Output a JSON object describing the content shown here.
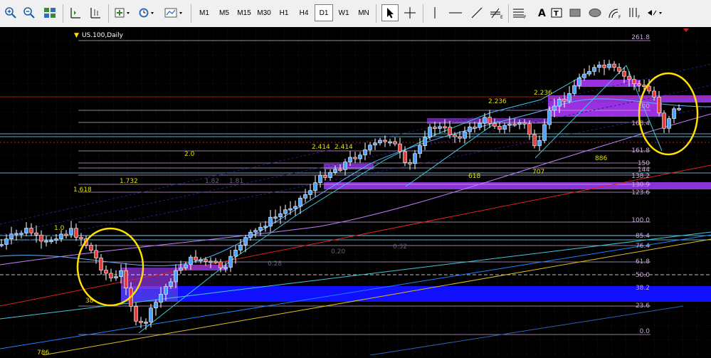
{
  "toolbar": {
    "timeframes": [
      "M1",
      "M5",
      "M15",
      "M30",
      "H1",
      "H4",
      "D1",
      "W1",
      "MN"
    ],
    "active_timeframe": "D1",
    "icons": [
      "zoom-in-icon",
      "zoom-out-icon",
      "tile-windows-icon",
      "chart-shift-icon",
      "autoscroll-icon",
      "new-order-icon",
      "periods-clock-icon",
      "templates-icon",
      "cursor-icon",
      "crosshair-icon",
      "horizontal-line-icon",
      "trendline-icon",
      "fibo-fan-icon",
      "fibo-retracement-icon",
      "text-label-icon",
      "rectangle-icon",
      "ellipse-icon",
      "fibo-arcs-icon",
      "fibo-time-icon",
      "arrows-dropdown-icon"
    ]
  },
  "chart": {
    "symbol_label": "US.100,Daily",
    "grid_color": "#8b0000",
    "fibo_color": "#c9a7d6",
    "highlight_color": "#ffe000",
    "right_levels": [
      "261.8",
      "100",
      "161.8",
      "150",
      "138.2",
      "130.9",
      "123.6",
      "100.0",
      "85.4",
      "76.4",
      "61.8",
      "50.0",
      "38.2",
      "23.6",
      "0.0"
    ],
    "level_overlap_label": "144",
    "level_partial_label": "168.4",
    "fan_labels": [
      "2.236",
      "2.236",
      "2.414",
      "2.414",
      "2.0",
      "1.732",
      "1.82",
      "1.81",
      "1.618",
      "1.0",
      "886",
      "707",
      "618",
      "786",
      "0.28",
      "0.20",
      "0.32",
      "38"
    ]
  }
}
